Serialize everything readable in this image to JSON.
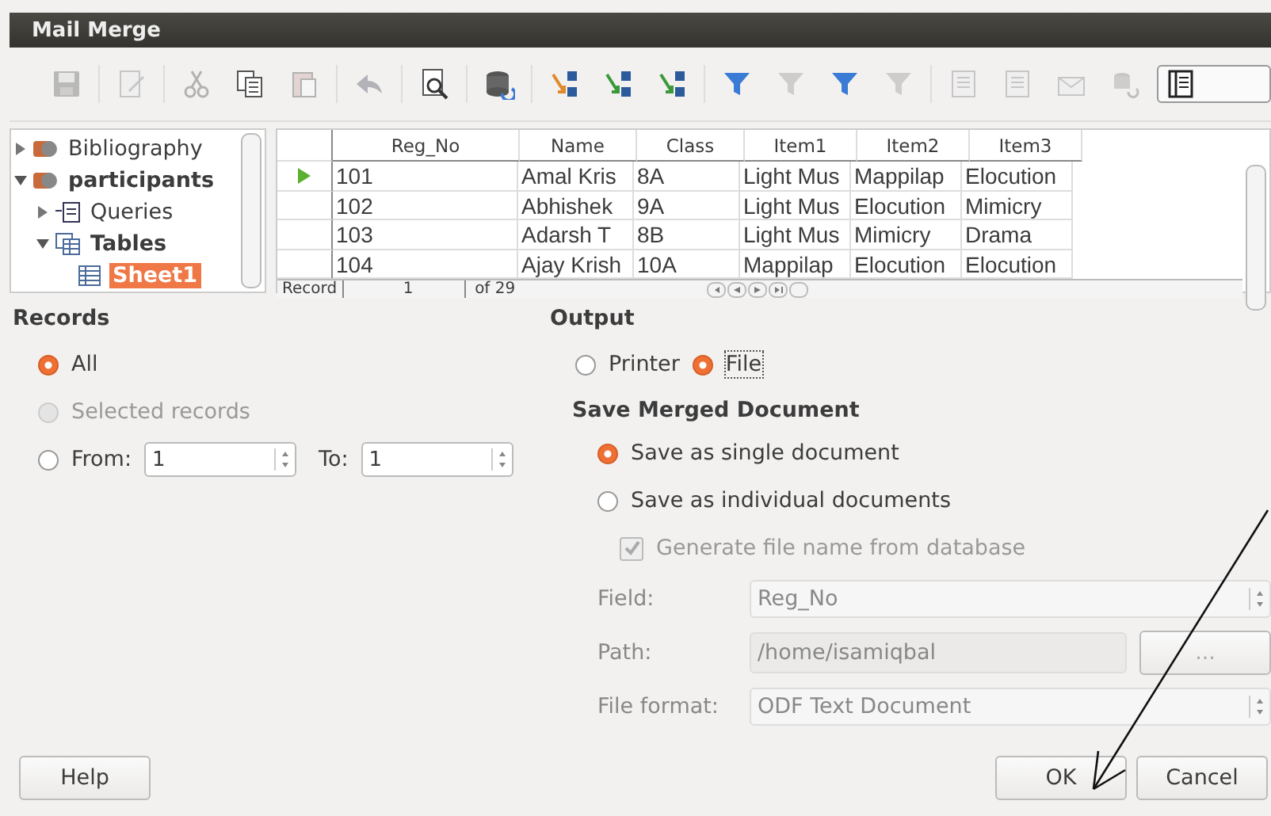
{
  "window": {
    "title": "Mail Merge"
  },
  "toolbar": [
    {
      "kind": "save",
      "disabled": true
    },
    {
      "kind": "edit",
      "disabled": true
    },
    {
      "kind": "cut",
      "disabled": true
    },
    {
      "kind": "copy",
      "disabled": false
    },
    {
      "kind": "paste",
      "disabled": true
    },
    {
      "kind": "undo",
      "disabled": true
    },
    {
      "kind": "preview",
      "disabled": false
    },
    {
      "kind": "database",
      "disabled": false
    },
    {
      "kind": "sort",
      "disabled": false
    },
    {
      "kind": "sort-asc",
      "disabled": false
    },
    {
      "kind": "sort-desc",
      "disabled": false
    },
    {
      "kind": "filter",
      "disabled": false
    },
    {
      "kind": "filter-check",
      "disabled": true
    },
    {
      "kind": "filter",
      "disabled": false
    },
    {
      "kind": "filter-remove",
      "disabled": true
    },
    {
      "kind": "text-block",
      "disabled": true
    },
    {
      "kind": "text-field",
      "disabled": true
    },
    {
      "kind": "envelope",
      "disabled": true
    },
    {
      "kind": "db-convert",
      "disabled": true
    },
    {
      "kind": "explorer",
      "disabled": false,
      "selected": true
    }
  ],
  "tree": [
    {
      "label": "Bibliography",
      "kind": "database",
      "expanded": false,
      "selected": false
    },
    {
      "label": "participants",
      "kind": "database",
      "expanded": true,
      "selected": false,
      "children": [
        {
          "label": "Queries",
          "kind": "queries",
          "expanded": false,
          "selected": false
        },
        {
          "label": "Tables",
          "kind": "tables",
          "expanded": true,
          "selected": false,
          "children": [
            {
              "label": "Sheet1",
              "kind": "table",
              "selected": true
            }
          ]
        }
      ]
    }
  ],
  "table": {
    "columns": [
      "Reg_No",
      "Name",
      "Class",
      "Item1",
      "Item2",
      "Item3"
    ],
    "rows": [
      {
        "current": true,
        "cells": [
          "101",
          "Amal Kris",
          "8A",
          "Light Mus",
          "Mappilap",
          "Elocution"
        ]
      },
      {
        "current": false,
        "cells": [
          "102",
          "Abhishek",
          "9A",
          "Light Mus",
          "Elocution",
          "Mimicry"
        ]
      },
      {
        "current": false,
        "cells": [
          "103",
          "Adarsh T",
          "8B",
          "Light Mus",
          "Mimicry",
          "Drama"
        ]
      },
      {
        "current": false,
        "cells": [
          "104",
          "Ajay Krish",
          "10A",
          "Mappilap",
          "Elocution",
          "Elocution"
        ]
      }
    ],
    "navigator": {
      "label": "Record",
      "value": "1",
      "total": "of 29"
    }
  },
  "records": {
    "title": "Records",
    "options": [
      {
        "label": "All",
        "selected": true,
        "disabled": false
      },
      {
        "label": "Selected records",
        "selected": false,
        "disabled": true
      },
      {
        "label": "From:",
        "selected": false,
        "disabled": false
      }
    ],
    "from": "1",
    "to_label": "To:",
    "to": "1"
  },
  "output": {
    "title": "Output",
    "options": [
      {
        "label": "Printer",
        "selected": false
      },
      {
        "label": "File",
        "selected": true
      }
    ],
    "save_title": "Save Merged Document",
    "save_options": [
      {
        "label": "Save as single document",
        "selected": true
      },
      {
        "label": "Save as individual documents",
        "selected": false
      }
    ],
    "generate": {
      "label": "Generate file name from database",
      "checked": true,
      "disabled": true
    },
    "fields": [
      {
        "kind": "select",
        "label": "Field:",
        "value": "Reg_No"
      },
      {
        "kind": "path",
        "label": "Path:",
        "value": "/home/isamiqbal",
        "button": "..."
      },
      {
        "kind": "select",
        "label": "File format:",
        "value": "ODF Text Document"
      }
    ]
  },
  "buttons": {
    "help": "Help",
    "ok": "OK",
    "cancel": "Cancel"
  }
}
